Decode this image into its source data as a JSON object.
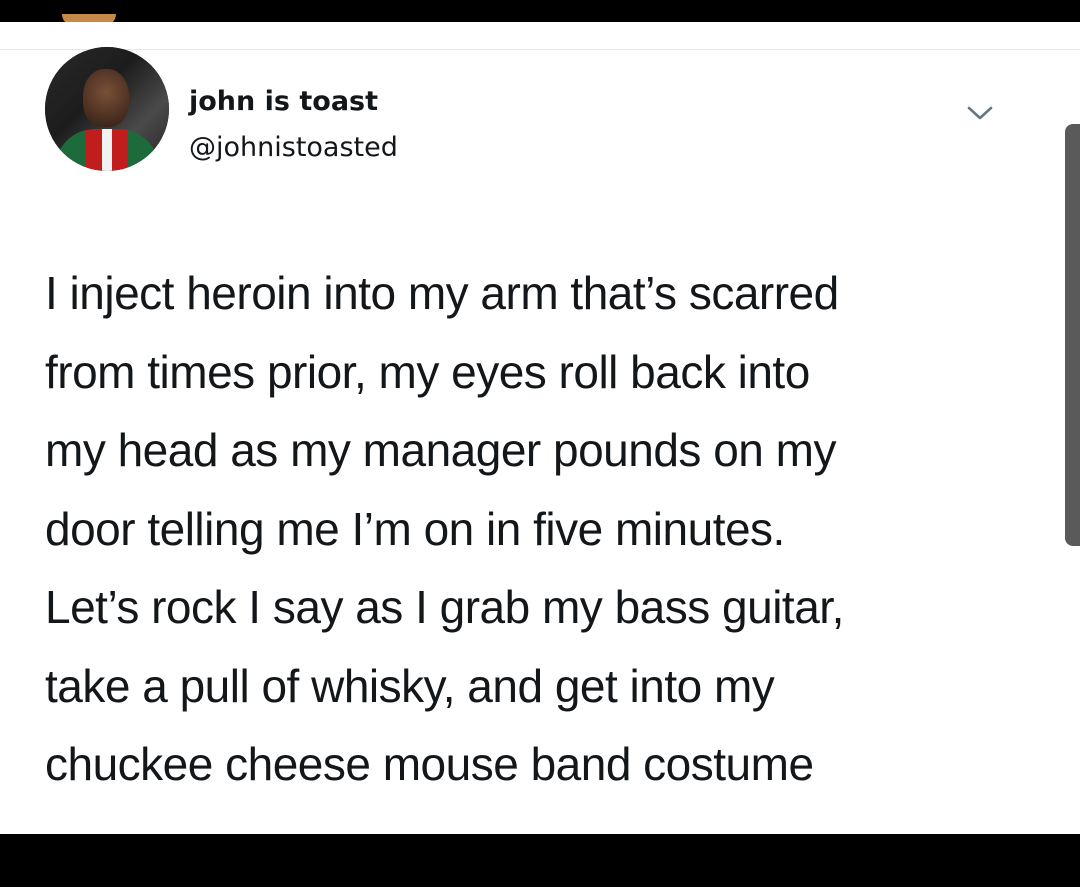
{
  "tweet": {
    "author": {
      "display_name": "john is toast",
      "handle": "@johnistoasted"
    },
    "text_lines": [
      "I inject heroin into my arm that’s scarred",
      "from times prior, my eyes roll back into",
      "my head as my manager pounds on my",
      "door telling me I’m on in five minutes.",
      "Let’s rock I say as I grab my bass guitar,",
      "take a pull of whisky, and get into my",
      "chuckee cheese mouse band costume"
    ],
    "menu_icon": "chevron-down-icon"
  },
  "colors": {
    "text": "#14171a",
    "background": "#ffffff",
    "frame": "#000000",
    "scrollbar": "#5a5a5a"
  }
}
